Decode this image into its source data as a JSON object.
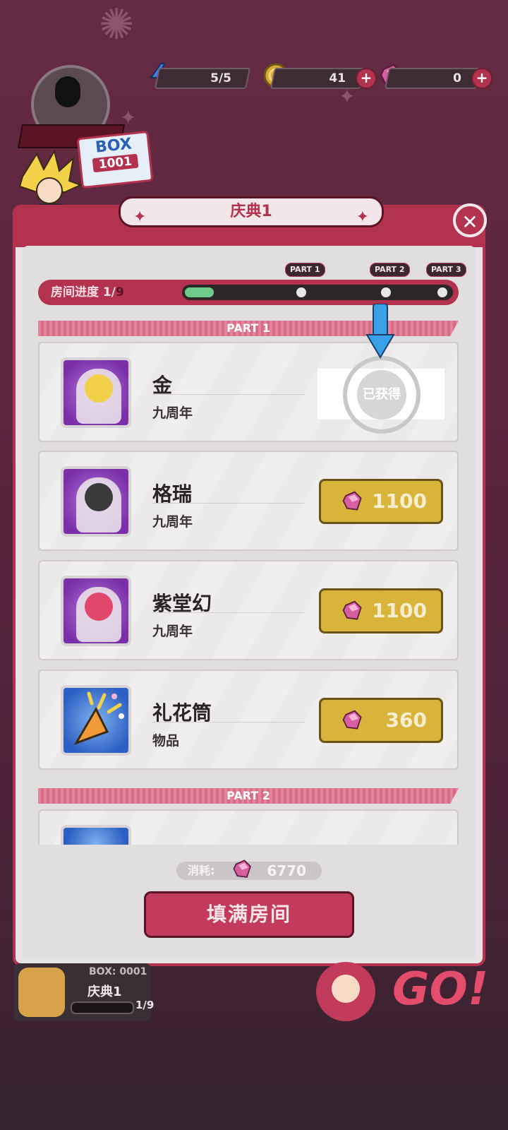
{
  "hud": {
    "energy_value": "5/5",
    "coin_value": "41",
    "gem_value": "0",
    "plus_symbol": "+"
  },
  "player": {
    "box_label": "BOX",
    "box_number": "1001"
  },
  "modal": {
    "title": "庆典1",
    "close_symbol": "✕",
    "progress_label": "房间进度",
    "progress_current": "1",
    "progress_sep": "/",
    "progress_total": "9",
    "progress_fraction": 0.11,
    "part_tags": [
      "PART 1",
      "PART 2",
      "PART 3"
    ]
  },
  "sections": [
    {
      "label": "PART 1"
    },
    {
      "label": "PART 2"
    }
  ],
  "items": [
    {
      "name": "金",
      "sub": "九周年",
      "status": "owned",
      "stamp_text": "已获得",
      "thumb": "purple"
    },
    {
      "name": "格瑞",
      "sub": "九周年",
      "price": "1100",
      "thumb": "purple"
    },
    {
      "name": "紫堂幻",
      "sub": "九周年",
      "price": "1100",
      "thumb": "purple"
    },
    {
      "name": "礼花筒",
      "sub": "物品",
      "price": "360",
      "thumb": "blue"
    }
  ],
  "footer": {
    "cost_label": "消耗:",
    "cost_value": "6770",
    "fill_button": "填满房间"
  },
  "bottom": {
    "box_text": "BOX: 0001",
    "name": "庆典1",
    "progress": "1/9",
    "go_text": "GO!"
  },
  "colors": {
    "accent": "#b3334f",
    "gold_button": "#d9b43a",
    "progress_fill": "#6ecb8a"
  },
  "icons": {
    "energy": "lightning-icon",
    "coin": "coin-icon",
    "gem": "pink-gem-icon",
    "close": "close-icon",
    "arrow": "down-arrow-icon"
  }
}
